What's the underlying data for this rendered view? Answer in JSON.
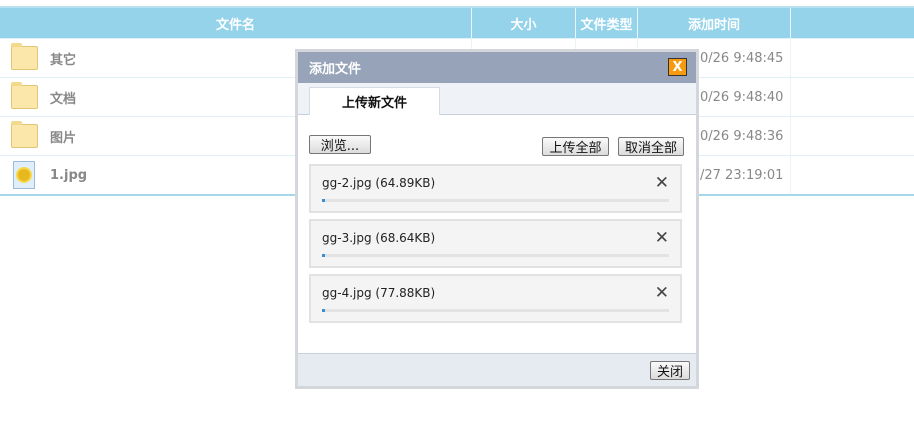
{
  "table": {
    "headers": [
      "文件名",
      "大小",
      "文件类型",
      "添加时间"
    ],
    "rows": [
      {
        "name": "其它",
        "icon": "folder-icon",
        "time": "0/26 9:48:45"
      },
      {
        "name": "文档",
        "icon": "folder-icon",
        "time": "0/26 9:48:40"
      },
      {
        "name": "图片",
        "icon": "folder-icon",
        "time": "0/26 9:48:36"
      },
      {
        "name": "1.jpg",
        "icon": "image-file-icon",
        "time": "/27 23:19:01"
      }
    ]
  },
  "dialog": {
    "title": "添加文件",
    "close_x": "X",
    "tab": "上传新文件",
    "browse": "浏览...",
    "upload_all": "上传全部",
    "cancel_all": "取消全部",
    "close": "关闭",
    "files": [
      {
        "name": "gg-2.jpg (64.89KB)",
        "remove": "✕",
        "progress": 0.01
      },
      {
        "name": "gg-3.jpg (68.64KB)",
        "remove": "✕",
        "progress": 0.01
      },
      {
        "name": "gg-4.jpg (77.88KB)",
        "remove": "✕",
        "progress": 0.01
      }
    ]
  }
}
